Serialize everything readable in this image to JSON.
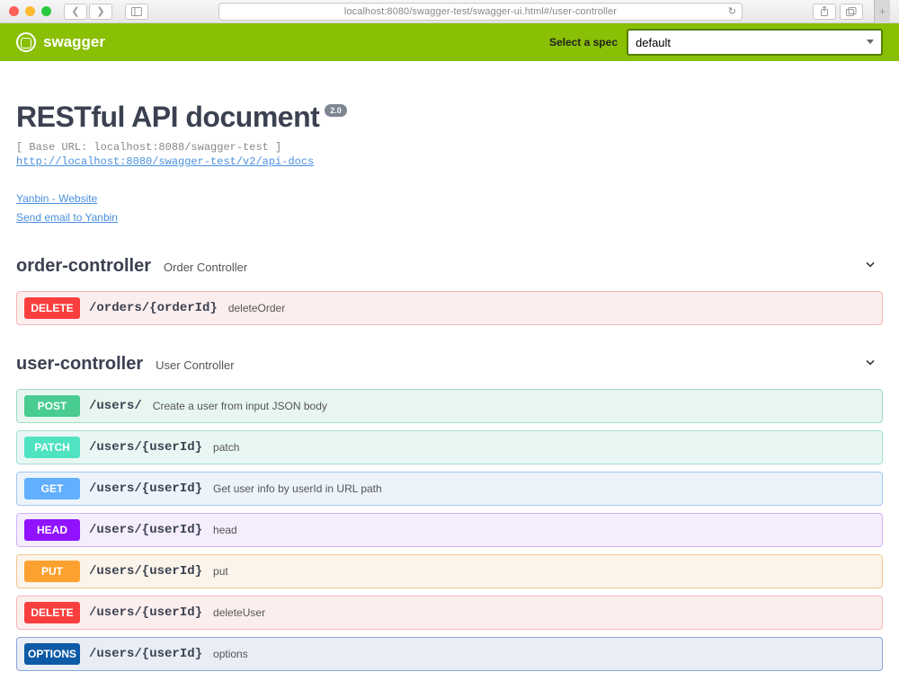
{
  "browser": {
    "url": "localhost:8080/swagger-test/swagger-ui.html#/user-controller"
  },
  "header": {
    "brand": "swagger",
    "spec_label": "Select a spec",
    "spec_value": "default"
  },
  "info": {
    "title": "RESTful API document",
    "version": "2.0",
    "base_url": "[ Base URL: localhost:8088/swagger-test ]",
    "api_docs_link": "http://localhost:8080/swagger-test/v2/api-docs",
    "contact_website": "Yanbin - Website",
    "contact_email": "Send email to Yanbin"
  },
  "tags": {
    "order": {
      "name": "order-controller",
      "desc": "Order Controller"
    },
    "user": {
      "name": "user-controller",
      "desc": "User Controller"
    }
  },
  "ops": {
    "o1": {
      "method": "DELETE",
      "path": "/orders/{orderId}",
      "summary": "deleteOrder"
    },
    "u1": {
      "method": "POST",
      "path": "/users/",
      "summary": "Create a user from input JSON body"
    },
    "u2": {
      "method": "PATCH",
      "path": "/users/{userId}",
      "summary": "patch"
    },
    "u3": {
      "method": "GET",
      "path": "/users/{userId}",
      "summary": "Get user info by userId in URL path"
    },
    "u4": {
      "method": "HEAD",
      "path": "/users/{userId}",
      "summary": "head"
    },
    "u5": {
      "method": "PUT",
      "path": "/users/{userId}",
      "summary": "put"
    },
    "u6": {
      "method": "DELETE",
      "path": "/users/{userId}",
      "summary": "deleteUser"
    },
    "u7": {
      "method": "OPTIONS",
      "path": "/users/{userId}",
      "summary": "options"
    }
  }
}
